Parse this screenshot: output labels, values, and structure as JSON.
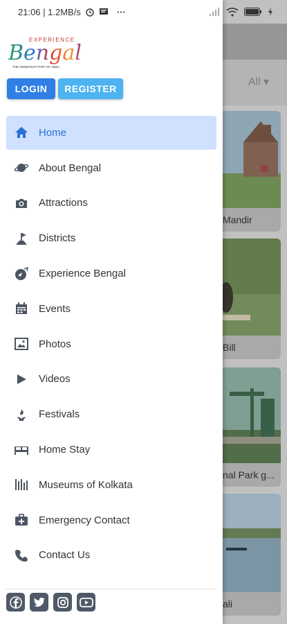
{
  "status_bar": {
    "time_speed": "21:06 | 1.2MB/s",
    "more": "···"
  },
  "background": {
    "filter_label": "All ▾",
    "cards": [
      {
        "caption": "Mandir"
      },
      {
        "caption": "Bill"
      },
      {
        "caption": "nal Park g..."
      },
      {
        "caption": "ali"
      }
    ]
  },
  "drawer": {
    "logo": {
      "word_small": "EXPERIENCE",
      "word_main": "Bengal",
      "tagline": "THE SWEETEST PART OF INDIA"
    },
    "login_label": "LOGIN",
    "register_label": "REGISTER",
    "menu": [
      {
        "label": "Home",
        "icon": "home-icon",
        "active": true
      },
      {
        "label": "About Bengal",
        "icon": "planet-icon"
      },
      {
        "label": "Attractions",
        "icon": "camera-icon"
      },
      {
        "label": "Districts",
        "icon": "flag-icon"
      },
      {
        "label": "Experience Bengal",
        "icon": "explore-icon"
      },
      {
        "label": "Events",
        "icon": "calendar-icon"
      },
      {
        "label": "Photos",
        "icon": "photos-icon"
      },
      {
        "label": "Videos",
        "icon": "play-icon"
      },
      {
        "label": "Festivals",
        "icon": "festival-icon"
      },
      {
        "label": "Home Stay",
        "icon": "bed-icon"
      },
      {
        "label": "Museums of Kolkata",
        "icon": "museum-icon"
      },
      {
        "label": "Emergency Contact",
        "icon": "medical-kit-icon"
      },
      {
        "label": "Contact Us",
        "icon": "phone-icon"
      }
    ],
    "socials": [
      "facebook-icon",
      "twitter-icon",
      "instagram-icon",
      "youtube-icon"
    ]
  },
  "colors": {
    "active_bg": "#cfe1ff",
    "active_text": "#2d6fd6",
    "login": "#2f7fe6",
    "register": "#4db3f1",
    "icon": "#4c5563"
  }
}
